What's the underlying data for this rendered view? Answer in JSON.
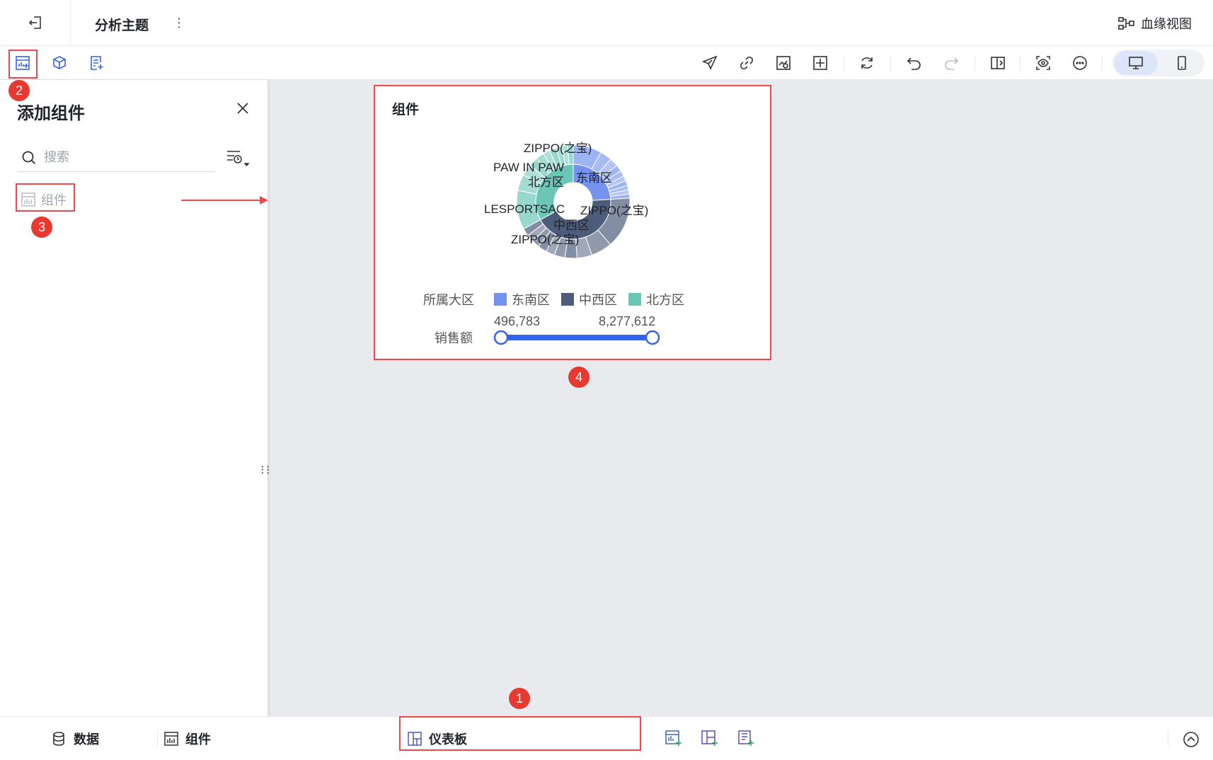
{
  "topbar": {
    "title": "分析主题",
    "more_glyph": "⋮",
    "lineage_label": "血缘视图"
  },
  "toolbar": {
    "left_icons": [
      "add-component-icon",
      "dataset-cube-icon",
      "add-text-icon"
    ],
    "right_icons": [
      "send-icon",
      "link-icon",
      "chart-search-icon",
      "layout-grid-icon",
      "refresh-icon",
      "undo-icon",
      "redo-icon",
      "split-view-icon",
      "preview-icon",
      "more-circle-icon"
    ],
    "device_modes": [
      "desktop",
      "mobile"
    ]
  },
  "panel": {
    "title": "添加组件",
    "search_placeholder": "搜索",
    "items": [
      {
        "label": "组件"
      }
    ]
  },
  "canvas": {
    "card_title": "组件"
  },
  "bottombar": {
    "tabs": [
      {
        "label": "数据"
      },
      {
        "label": "组件"
      },
      {
        "label": "仪表板"
      }
    ]
  },
  "annotations": {
    "badges": [
      "1",
      "2",
      "3",
      "4"
    ],
    "highlight_color": "#e84a4f",
    "badge_color": "#e8382f"
  },
  "chart_data": {
    "type": "sunburst",
    "title": "组件",
    "inner_ring": [
      {
        "name": "东南区",
        "value": 24,
        "color": "#7592ed"
      },
      {
        "name": "中西区",
        "value": 43,
        "color": "#4e5c7b"
      },
      {
        "name": "北方区",
        "value": 33,
        "color": "#6cc6b8"
      }
    ],
    "outer_ring_labels": [
      "ZIPPO(之宝)",
      "ZIPPO(之宝)",
      "ZIPPO(之宝)",
      "PAW IN PAW",
      "LESPORTSAC"
    ],
    "legend": {
      "title": "所属大区",
      "entries": [
        {
          "name": "东南区",
          "color": "#7592ed"
        },
        {
          "name": "中西区",
          "color": "#4e5c7b"
        },
        {
          "name": "北方区",
          "color": "#6cc6b8"
        }
      ]
    },
    "range_slider": {
      "label": "销售额",
      "min": "496,783",
      "max": "8,277,612",
      "color": "#3563e9"
    }
  }
}
